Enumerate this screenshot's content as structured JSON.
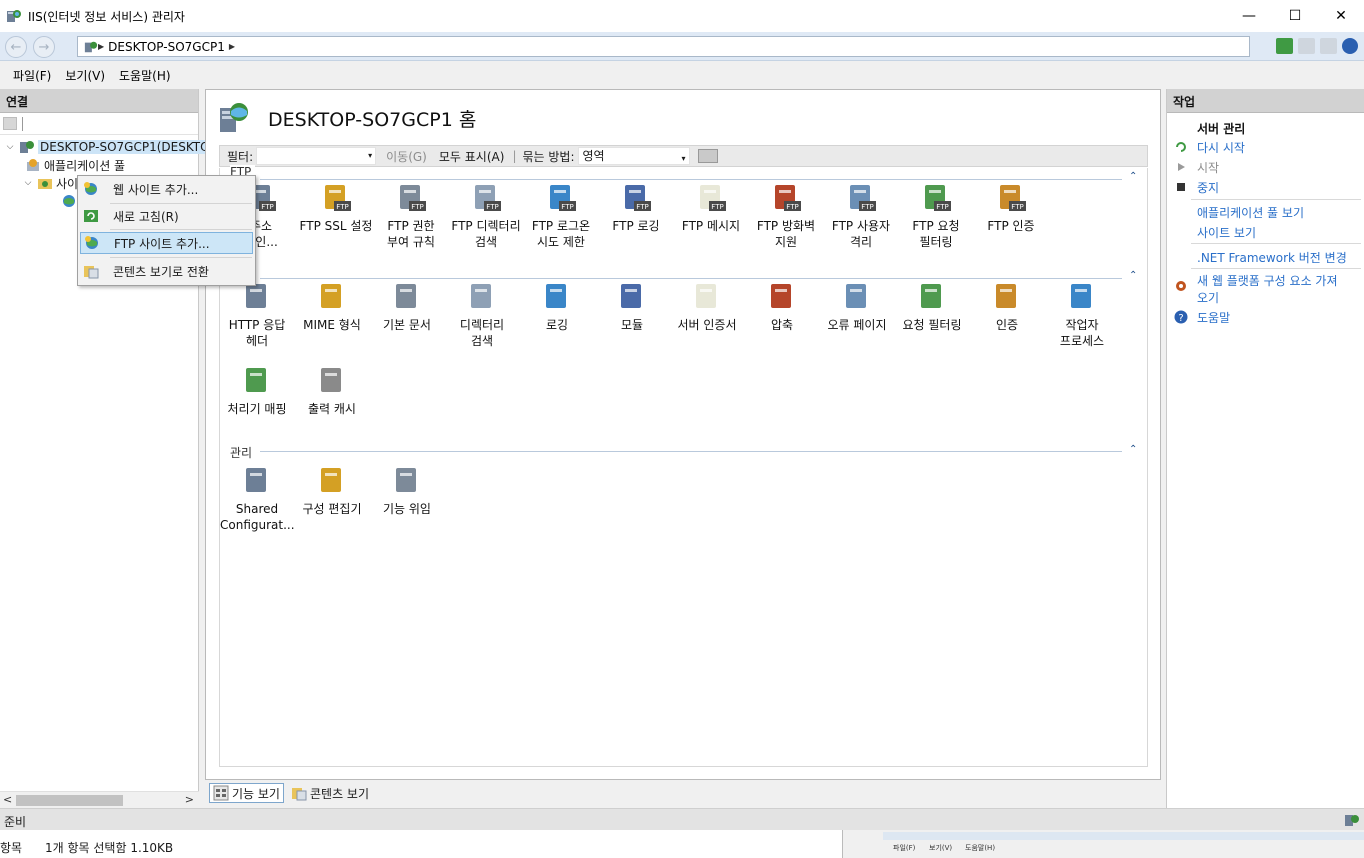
{
  "window": {
    "title": "IIS(인터넷 정보 서비스) 관리자",
    "minimize": "—",
    "maximize": "☐",
    "close": "✕"
  },
  "address": {
    "back": "←",
    "forward": "→",
    "segment": "DESKTOP-SO7GCP1",
    "sep": "▶"
  },
  "menu": {
    "file": "파일(F)",
    "view": "보기(V)",
    "help": "도움말(H)"
  },
  "connections": {
    "header": "연결",
    "server_node": "DESKTOP-SO7GCP1(DESKTO",
    "app_pools": "애플리케이션 풀",
    "sites": "사이트",
    "sites_visible": "사이",
    "expand": "⌵",
    "scroll_left": "<",
    "scroll_right": ">"
  },
  "context_menu": {
    "add_website": "웹 사이트 추가...",
    "refresh": "새로 고침(R)",
    "add_ftp_site": "FTP 사이트 추가...",
    "switch_content_view": "콘텐츠 보기로 전환"
  },
  "home": {
    "title": "DESKTOP-SO7GCP1 홈",
    "filter_label": "필터:",
    "go_label": "이동(G)",
    "show_all": "모두 표시(A)",
    "group_by_label": "묶는 방법:",
    "group_by_value": "영역",
    "dropdown": "▾",
    "collapse": "⌃"
  },
  "groups": {
    "ftp": "FTP",
    "iis": "IIS",
    "management": "관리"
  },
  "ftp_features": [
    {
      "label": "FTP IP 주소 및 도메인 제한",
      "line1": "주소",
      "line2": "메인..."
    },
    {
      "label": "FTP SSL 설정",
      "line1": "FTP SSL 설정",
      "line2": ""
    },
    {
      "label": "FTP 권한 부여 규칙",
      "line1": "FTP 권한",
      "line2": "부여 규칙"
    },
    {
      "label": "FTP 디렉터리 검색",
      "line1": "FTP 디렉터리",
      "line2": "검색"
    },
    {
      "label": "FTP 로그온 시도 제한",
      "line1": "FTP 로그온",
      "line2": "시도 제한"
    },
    {
      "label": "FTP 로깅",
      "line1": "FTP 로깅",
      "line2": ""
    },
    {
      "label": "FTP 메시지",
      "line1": "FTP 메시지",
      "line2": ""
    },
    {
      "label": "FTP 방화벽 지원",
      "line1": "FTP 방화벽",
      "line2": "지원"
    },
    {
      "label": "FTP 사용자 격리",
      "line1": "FTP 사용자",
      "line2": "격리"
    },
    {
      "label": "FTP 요청 필터링",
      "line1": "FTP 요청",
      "line2": "필터링"
    },
    {
      "label": "FTP 인증",
      "line1": "FTP 인증",
      "line2": ""
    }
  ],
  "iis_features": [
    {
      "line1": "HTTP 응답",
      "line2": "헤더"
    },
    {
      "line1": "MIME 형식",
      "line2": ""
    },
    {
      "line1": "기본 문서",
      "line2": ""
    },
    {
      "line1": "디렉터리",
      "line2": "검색"
    },
    {
      "line1": "로깅",
      "line2": ""
    },
    {
      "line1": "모듈",
      "line2": ""
    },
    {
      "line1": "서버 인증서",
      "line2": ""
    },
    {
      "line1": "압축",
      "line2": ""
    },
    {
      "line1": "오류 페이지",
      "line2": ""
    },
    {
      "line1": "요청 필터링",
      "line2": ""
    },
    {
      "line1": "인증",
      "line2": ""
    },
    {
      "line1": "작업자",
      "line2": "프로세스"
    },
    {
      "line1": "처리기 매핑",
      "line2": ""
    },
    {
      "line1": "출력 캐시",
      "line2": ""
    }
  ],
  "management_features": [
    {
      "line1": "Shared",
      "line2": "Configurat..."
    },
    {
      "line1": "구성 편집기",
      "line2": ""
    },
    {
      "line1": "기능 위임",
      "line2": ""
    }
  ],
  "view_tabs": {
    "features": "기능 보기",
    "content": "콘텐츠 보기"
  },
  "actions": {
    "header": "작업",
    "manage_server": "서버 관리",
    "restart": "다시 시작",
    "start": "시작",
    "stop": "중지",
    "view_app_pools": "애플리케이션 풀 보기",
    "view_sites": "사이트 보기",
    "net_version": ".NET Framework 버전 변경",
    "get_platform_1": "새 웹 플랫폼 구성 요소 가져",
    "get_platform_2": "오기",
    "help": "도움말"
  },
  "status": {
    "ready": "준비",
    "items": "항목",
    "selection": "1개 항목 선택함 1.10KB",
    "mini_menu": [
      "파일(F)",
      "보기(V)",
      "도움말(H)"
    ]
  },
  "colors": {
    "accent_link": "#2a6fc9",
    "selection": "#cce4f7",
    "header_gray": "#d2d2d2"
  }
}
